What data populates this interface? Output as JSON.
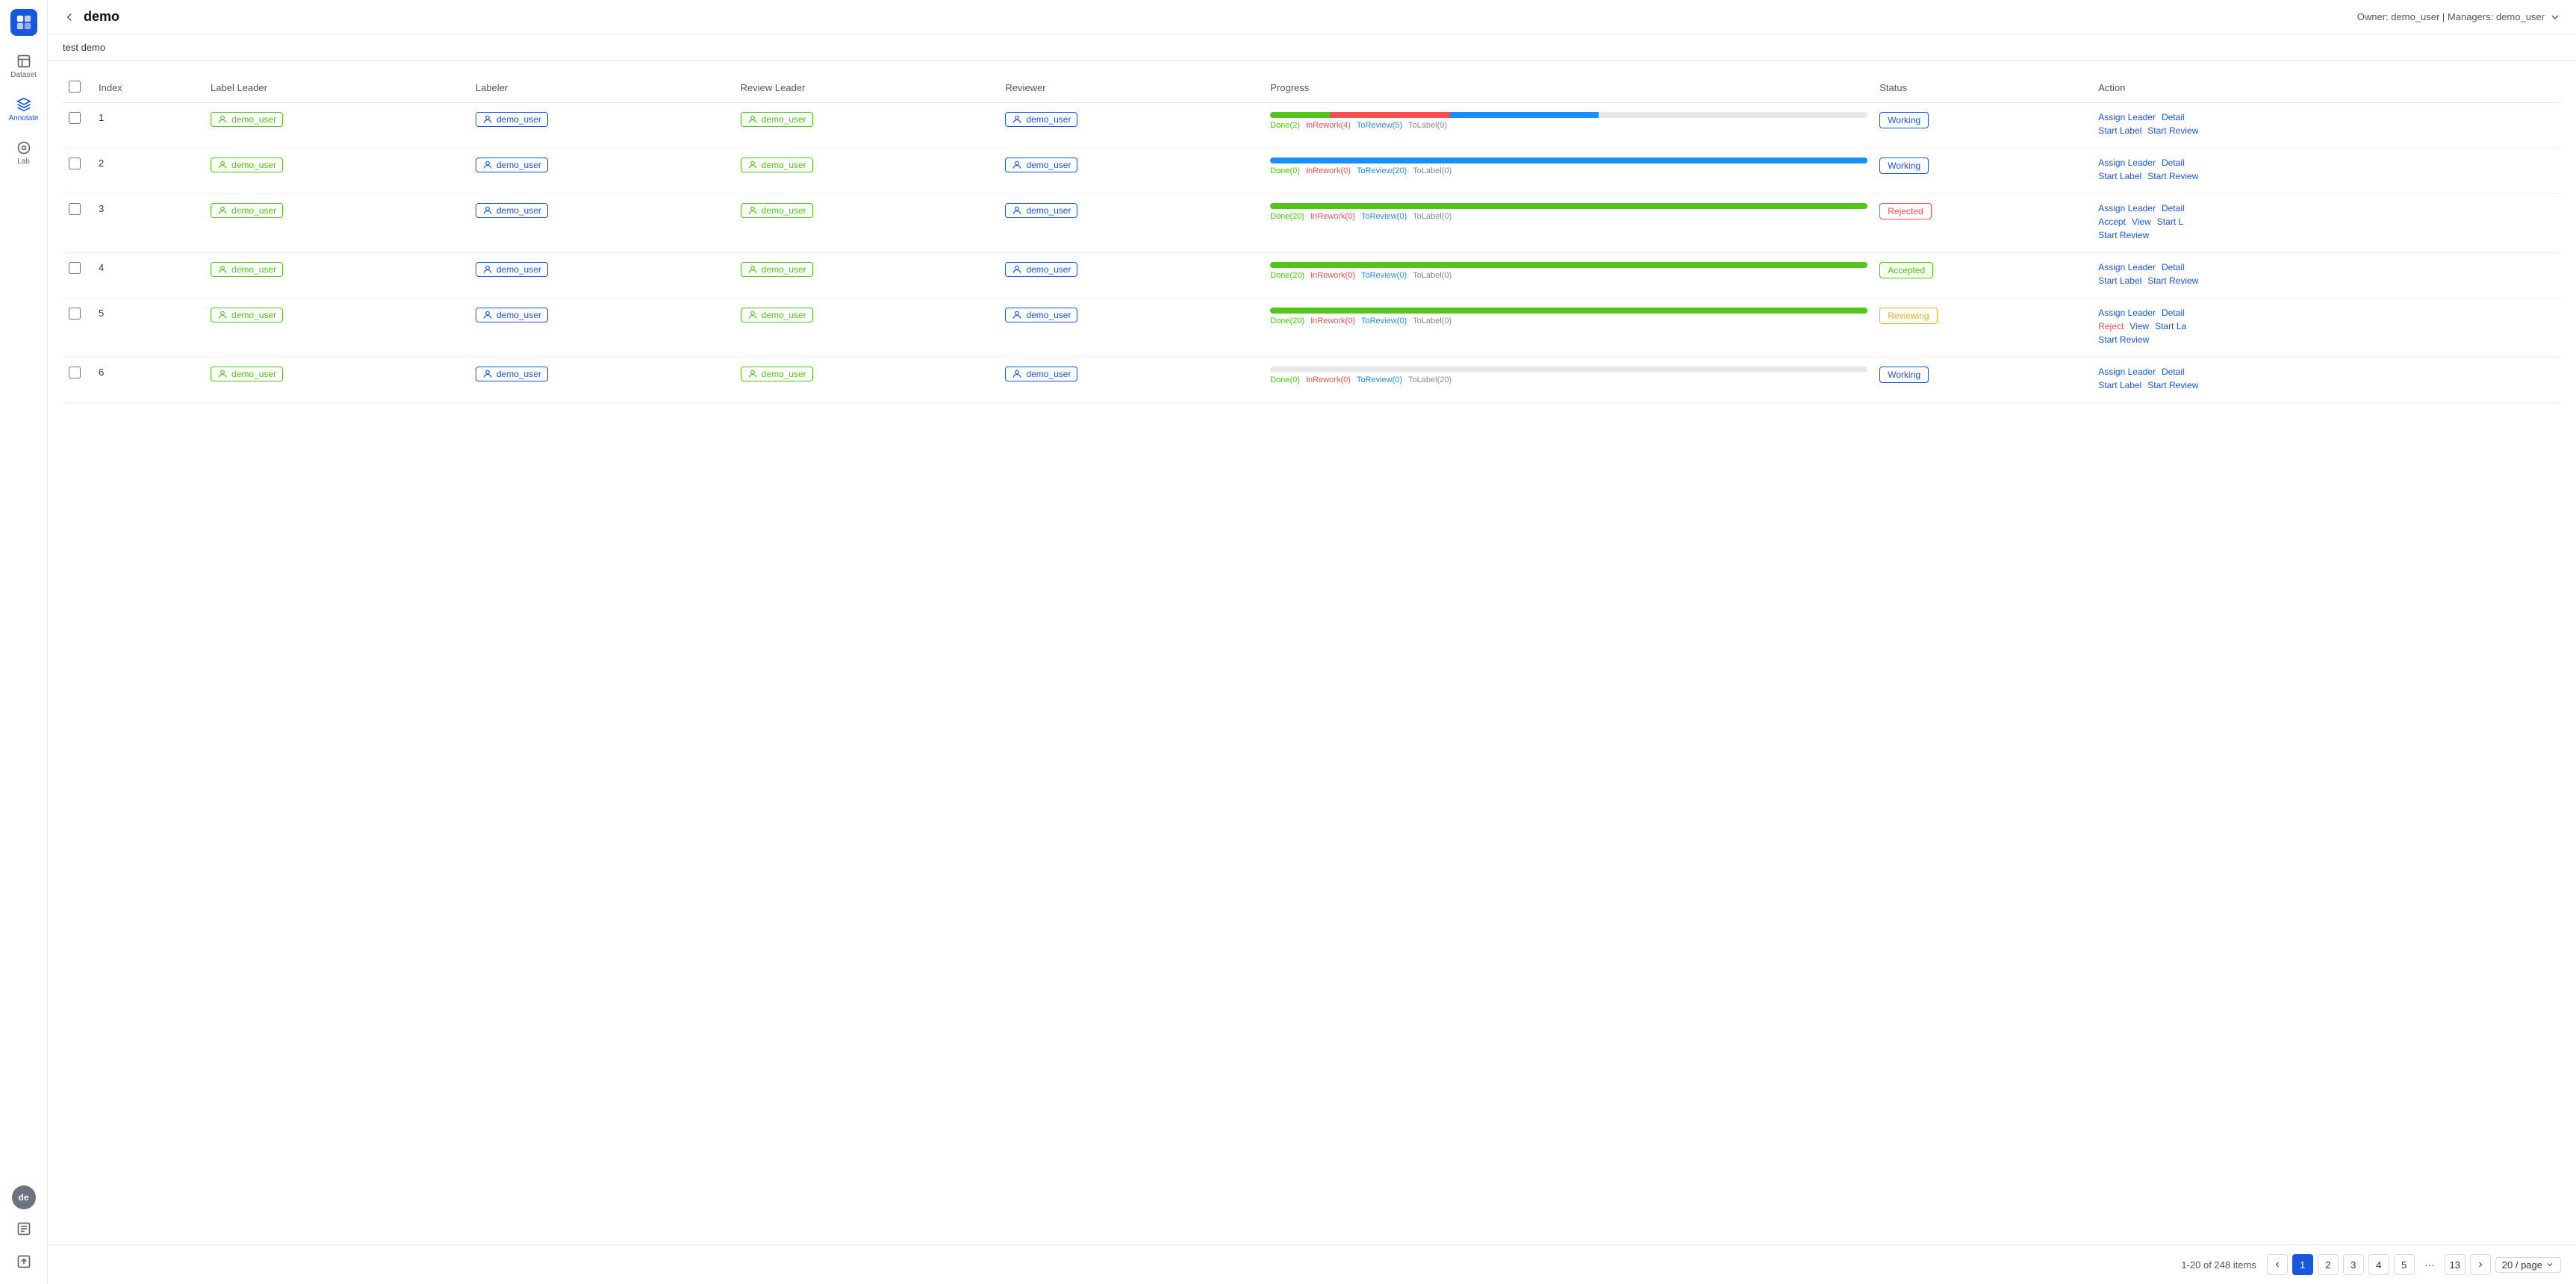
{
  "sidebar": {
    "logo_label": "Logo",
    "items": [
      {
        "id": "dataset",
        "label": "Dataset",
        "active": false
      },
      {
        "id": "annotate",
        "label": "Annotate",
        "active": true
      },
      {
        "id": "lab",
        "label": "Lab",
        "active": false
      }
    ],
    "avatar_initials": "de"
  },
  "header": {
    "back_label": "←",
    "title": "demo",
    "owner_info": "Owner: demo_user | Managers: demo_user"
  },
  "sub_header": {
    "project_name": "test demo"
  },
  "table": {
    "columns": [
      "Index",
      "Label Leader",
      "Labeler",
      "Review Leader",
      "Reviewer",
      "Progress",
      "Status",
      "Action"
    ],
    "rows": [
      {
        "index": 1,
        "label_leader": "demo_user",
        "labeler": "demo_user",
        "review_leader": "demo_user",
        "reviewer": "demo_user",
        "progress": {
          "done": 2,
          "rework": 4,
          "review": 5,
          "tolabel": 9,
          "total": 20,
          "done_pct": 10,
          "rework_pct": 20,
          "review_pct": 25,
          "tolabel_pct": 45,
          "label": "Done(2)  InRework(4)  ToReview(5)  ToLabel(9)"
        },
        "status": "Working",
        "status_class": "status-working",
        "actions": [
          [
            {
              "label": "Assign Leader",
              "class": "action-link"
            },
            {
              "label": "Detail",
              "class": "action-link"
            }
          ],
          [
            {
              "label": "Start Label",
              "class": "action-link"
            },
            {
              "label": "Start Review",
              "class": "action-link"
            }
          ]
        ]
      },
      {
        "index": 2,
        "label_leader": "demo_user",
        "labeler": "demo_user",
        "review_leader": "demo_user",
        "reviewer": "demo_user",
        "progress": {
          "done": 0,
          "rework": 0,
          "review": 20,
          "tolabel": 0,
          "total": 20,
          "done_pct": 0,
          "rework_pct": 0,
          "review_pct": 100,
          "tolabel_pct": 0,
          "label": "Done(0)  InRework(0)  ToReview(20)  ToLabel(0)"
        },
        "status": "Working",
        "status_class": "status-working",
        "actions": [
          [
            {
              "label": "Assign Leader",
              "class": "action-link"
            },
            {
              "label": "Detail",
              "class": "action-link"
            }
          ],
          [
            {
              "label": "Start Label",
              "class": "action-link"
            },
            {
              "label": "Start Review",
              "class": "action-link"
            }
          ]
        ]
      },
      {
        "index": 3,
        "label_leader": "demo_user",
        "labeler": "demo_user",
        "review_leader": "demo_user",
        "reviewer": "demo_user",
        "progress": {
          "done": 20,
          "rework": 0,
          "review": 0,
          "tolabel": 0,
          "total": 20,
          "done_pct": 100,
          "rework_pct": 0,
          "review_pct": 0,
          "tolabel_pct": 0,
          "label": "Done(20)  InRework(0)  ToReview(0)  ToLabel(0)"
        },
        "status": "Rejected",
        "status_class": "status-rejected",
        "actions": [
          [
            {
              "label": "Assign Leader",
              "class": "action-link"
            },
            {
              "label": "Detail",
              "class": "action-link"
            }
          ],
          [
            {
              "label": "Accept",
              "class": "action-link"
            },
            {
              "label": "View",
              "class": "action-link"
            },
            {
              "label": "Start L",
              "class": "action-link"
            }
          ],
          [
            {
              "label": "Start Review",
              "class": "action-link"
            }
          ]
        ]
      },
      {
        "index": 4,
        "label_leader": "demo_user",
        "labeler": "demo_user",
        "review_leader": "demo_user",
        "reviewer": "demo_user",
        "progress": {
          "done": 20,
          "rework": 0,
          "review": 0,
          "tolabel": 0,
          "total": 20,
          "done_pct": 100,
          "rework_pct": 0,
          "review_pct": 0,
          "tolabel_pct": 0,
          "label": "Done(20)  InRework(0)  ToReview(0)  ToLabel(0)"
        },
        "status": "Accepted",
        "status_class": "status-accepted",
        "actions": [
          [
            {
              "label": "Assign Leader",
              "class": "action-link"
            },
            {
              "label": "Detail",
              "class": "action-link"
            }
          ],
          [
            {
              "label": "Start Label",
              "class": "action-link"
            },
            {
              "label": "Start Review",
              "class": "action-link"
            }
          ]
        ]
      },
      {
        "index": 5,
        "label_leader": "demo_user",
        "labeler": "demo_user",
        "review_leader": "demo_user",
        "reviewer": "demo_user",
        "progress": {
          "done": 20,
          "rework": 0,
          "review": 0,
          "tolabel": 0,
          "total": 20,
          "done_pct": 100,
          "rework_pct": 0,
          "review_pct": 0,
          "tolabel_pct": 0,
          "label": "Done(20)  InRework(0)  ToReview(0)  ToLabel(0)"
        },
        "status": "Reviewing",
        "status_class": "status-reviewing",
        "actions": [
          [
            {
              "label": "Assign Leader",
              "class": "action-link"
            },
            {
              "label": "Detail",
              "class": "action-link"
            }
          ],
          [
            {
              "label": "Reject",
              "class": "action-link red"
            },
            {
              "label": "View",
              "class": "action-link"
            },
            {
              "label": "Start La",
              "class": "action-link"
            }
          ],
          [
            {
              "label": "Start Review",
              "class": "action-link"
            }
          ]
        ]
      },
      {
        "index": 6,
        "label_leader": "demo_user",
        "labeler": "demo_user",
        "review_leader": "demo_user",
        "reviewer": "demo_user",
        "progress": {
          "done": 0,
          "rework": 0,
          "review": 0,
          "tolabel": 20,
          "total": 20,
          "done_pct": 0,
          "rework_pct": 0,
          "review_pct": 0,
          "tolabel_pct": 100,
          "label": "Done(0)  InRework(0)  ToReview(0)  ToLabel(20)"
        },
        "status": "Working",
        "status_class": "status-working",
        "actions": [
          [
            {
              "label": "Assign Leader",
              "class": "action-link"
            },
            {
              "label": "Detail",
              "class": "action-link"
            }
          ],
          [
            {
              "label": "Start Label",
              "class": "action-link"
            },
            {
              "label": "Start Review",
              "class": "action-link"
            }
          ]
        ]
      }
    ]
  },
  "pagination": {
    "summary": "1-20 of 248 items",
    "current_page": 1,
    "pages": [
      1,
      2,
      3,
      4,
      5,
      "...",
      13
    ],
    "page_size": "20 / page"
  }
}
